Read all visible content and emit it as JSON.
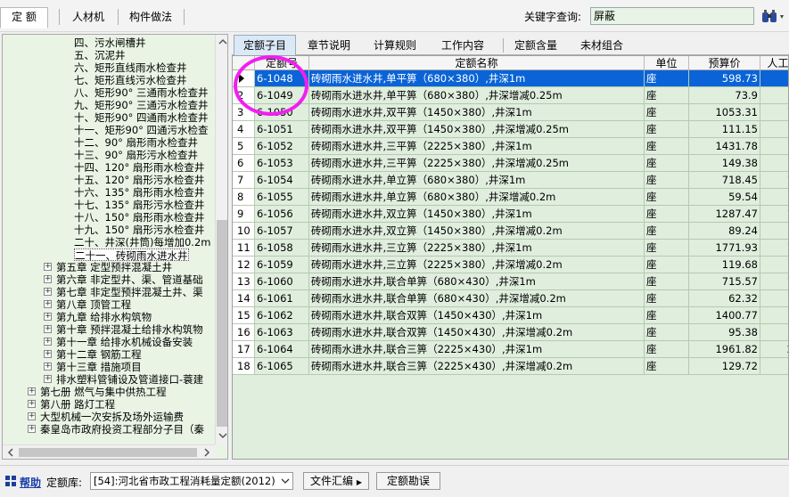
{
  "toolbar": {
    "tab_quota": "定  额",
    "tab_materials": "人材机",
    "tab_component": "构件做法",
    "keyword_label": "关键字查询:",
    "keyword_value": "屏蔽"
  },
  "tree": {
    "items": [
      {
        "label": "四、污水闸槽井",
        "indent": 80,
        "toggle": "",
        "selected": false
      },
      {
        "label": "五、沉泥井",
        "indent": 80,
        "toggle": "",
        "selected": false
      },
      {
        "label": "六、矩形直线雨水检查井",
        "indent": 80,
        "toggle": "",
        "selected": false
      },
      {
        "label": "七、矩形直线污水检查井",
        "indent": 80,
        "toggle": "",
        "selected": false
      },
      {
        "label": "八、矩形90° 三通雨水检查井",
        "indent": 80,
        "toggle": "",
        "selected": false
      },
      {
        "label": "九、矩形90° 三通污水检查井",
        "indent": 80,
        "toggle": "",
        "selected": false
      },
      {
        "label": "十、矩形90° 四通雨水检查井",
        "indent": 80,
        "toggle": "",
        "selected": false
      },
      {
        "label": "十一、矩形90° 四通污水检查",
        "indent": 80,
        "toggle": "",
        "selected": false
      },
      {
        "label": "十二、90° 扇形雨水检查井",
        "indent": 80,
        "toggle": "",
        "selected": false
      },
      {
        "label": "十三、90° 扇形污水检查井",
        "indent": 80,
        "toggle": "",
        "selected": false
      },
      {
        "label": "十四、120° 扇形雨水检查井",
        "indent": 80,
        "toggle": "",
        "selected": false
      },
      {
        "label": "十五、120° 扇形污水检查井",
        "indent": 80,
        "toggle": "",
        "selected": false
      },
      {
        "label": "十六、135° 扇形雨水检查井",
        "indent": 80,
        "toggle": "",
        "selected": false
      },
      {
        "label": "十七、135° 扇形污水检查井",
        "indent": 80,
        "toggle": "",
        "selected": false
      },
      {
        "label": "十八、150° 扇形雨水检查井",
        "indent": 80,
        "toggle": "",
        "selected": false
      },
      {
        "label": "十九、150° 扇形污水检查井",
        "indent": 80,
        "toggle": "",
        "selected": false
      },
      {
        "label": "二十、井深(井筒)每增加0.2m",
        "indent": 80,
        "toggle": "",
        "selected": false
      },
      {
        "label": "二十一、砖砌雨水进水井",
        "indent": 80,
        "toggle": "",
        "selected": true
      },
      {
        "label": "第五章 定型预拌混凝土井",
        "indent": 60,
        "toggle": "+",
        "selected": false
      },
      {
        "label": "第六章 非定型井、渠、管道基础",
        "indent": 60,
        "toggle": "+",
        "selected": false
      },
      {
        "label": "第七章 非定型预拌混凝土井、渠",
        "indent": 60,
        "toggle": "+",
        "selected": false
      },
      {
        "label": "第八章 顶管工程",
        "indent": 60,
        "toggle": "+",
        "selected": false
      },
      {
        "label": "第九章 给排水构筑物",
        "indent": 60,
        "toggle": "+",
        "selected": false
      },
      {
        "label": "第十章 预拌混凝土给排水构筑物",
        "indent": 60,
        "toggle": "+",
        "selected": false
      },
      {
        "label": "第十一章 给排水机械设备安装",
        "indent": 60,
        "toggle": "+",
        "selected": false
      },
      {
        "label": "第十二章 钢筋工程",
        "indent": 60,
        "toggle": "+",
        "selected": false
      },
      {
        "label": "第十三章 措施项目",
        "indent": 60,
        "toggle": "+",
        "selected": false
      },
      {
        "label": "排水塑料管铺设及管道接口-蓑建",
        "indent": 60,
        "toggle": "+",
        "selected": false
      },
      {
        "label": "第七册 燃气与集中供热工程",
        "indent": 42,
        "toggle": "+",
        "selected": false
      },
      {
        "label": "第八册 路灯工程",
        "indent": 42,
        "toggle": "+",
        "selected": false
      },
      {
        "label": "大型机械一次安拆及场外运输费",
        "indent": 42,
        "toggle": "+",
        "selected": false
      },
      {
        "label": "秦皇岛市政府投资工程部分子目（秦",
        "indent": 42,
        "toggle": "+",
        "selected": false
      }
    ]
  },
  "tabs": [
    {
      "label": "定额子目",
      "active": true
    },
    {
      "label": "章节说明",
      "active": false
    },
    {
      "label": "计算规则",
      "active": false
    },
    {
      "label": "工作内容",
      "active": false
    },
    {
      "label": "定额含量",
      "active": false
    },
    {
      "label": "未材组合",
      "active": false
    }
  ],
  "table": {
    "headers": [
      "定额号",
      "定额名称",
      "单位",
      "预算价",
      "人工"
    ],
    "rows": [
      {
        "rn": "",
        "code": "6-1048",
        "name": "砖砌雨水进水井,单平箅（680×380）,井深1m",
        "unit": "座",
        "price": "598.73",
        "labor": "",
        "selected": true
      },
      {
        "rn": "2",
        "code": "6-1049",
        "name": "砖砌雨水进水井,单平箅（680×380）,井深增减0.25m",
        "unit": "座",
        "price": "73.9",
        "labor": "",
        "selected": false
      },
      {
        "rn": "3",
        "code": "6-1050",
        "name": "砖砌雨水进水井,双平箅（1450×380）,井深1m",
        "unit": "座",
        "price": "1053.31",
        "labor": "1",
        "selected": false
      },
      {
        "rn": "4",
        "code": "6-1051",
        "name": "砖砌雨水进水井,双平箅（1450×380）,井深增减0.25m",
        "unit": "座",
        "price": "111.15",
        "labor": "",
        "selected": false
      },
      {
        "rn": "5",
        "code": "6-1052",
        "name": "砖砌雨水进水井,三平箅（2225×380）,井深1m",
        "unit": "座",
        "price": "1431.78",
        "labor": "",
        "selected": false
      },
      {
        "rn": "6",
        "code": "6-1053",
        "name": "砖砌雨水进水井,三平箅（2225×380）,井深增减0.25m",
        "unit": "座",
        "price": "149.38",
        "labor": "",
        "selected": false
      },
      {
        "rn": "7",
        "code": "6-1054",
        "name": "砖砌雨水进水井,单立箅（680×380）,井深1m",
        "unit": "座",
        "price": "718.45",
        "labor": "1",
        "selected": false
      },
      {
        "rn": "8",
        "code": "6-1055",
        "name": "砖砌雨水进水井,单立箅（680×380）,井深增减0.2m",
        "unit": "座",
        "price": "59.54",
        "labor": "",
        "selected": false
      },
      {
        "rn": "9",
        "code": "6-1056",
        "name": "砖砌雨水进水井,双立箅（1450×380）,井深1m",
        "unit": "座",
        "price": "1287.47",
        "labor": "1",
        "selected": false
      },
      {
        "rn": "10",
        "code": "6-1057",
        "name": "砖砌雨水进水井,双立箅（1450×380）,井深增减0.2m",
        "unit": "座",
        "price": "89.24",
        "labor": "",
        "selected": false
      },
      {
        "rn": "11",
        "code": "6-1058",
        "name": "砖砌雨水进水井,三立箅（2225×380）,井深1m",
        "unit": "座",
        "price": "1771.93",
        "labor": "1",
        "selected": false
      },
      {
        "rn": "12",
        "code": "6-1059",
        "name": "砖砌雨水进水井,三立箅（2225×380）,井深增减0.2m",
        "unit": "座",
        "price": "119.68",
        "labor": "",
        "selected": false
      },
      {
        "rn": "13",
        "code": "6-1060",
        "name": "砖砌雨水进水井,联合单箅（680×430）,井深1m",
        "unit": "座",
        "price": "715.57",
        "labor": "1",
        "selected": false
      },
      {
        "rn": "14",
        "code": "6-1061",
        "name": "砖砌雨水进水井,联合单箅（680×430）,井深增减0.2m",
        "unit": "座",
        "price": "62.32",
        "labor": "",
        "selected": false
      },
      {
        "rn": "15",
        "code": "6-1062",
        "name": "砖砌雨水进水井,联合双箅（1450×430）,井深1m",
        "unit": "座",
        "price": "1400.77",
        "labor": "",
        "selected": false
      },
      {
        "rn": "16",
        "code": "6-1063",
        "name": "砖砌雨水进水井,联合双箅（1450×430）,井深增减0.2m",
        "unit": "座",
        "price": "95.38",
        "labor": "",
        "selected": false
      },
      {
        "rn": "17",
        "code": "6-1064",
        "name": "砖砌雨水进水井,联合三箅（2225×430）,井深1m",
        "unit": "座",
        "price": "1961.82",
        "labor": "2",
        "selected": false
      },
      {
        "rn": "18",
        "code": "6-1065",
        "name": "砖砌雨水进水井,联合三箅（2225×430）,井深增减0.2m",
        "unit": "座",
        "price": "129.72",
        "labor": "",
        "selected": false
      }
    ]
  },
  "bottom": {
    "help_label": "帮助",
    "lib_label": "定额库:",
    "lib_value": "[54]:河北省市政工程消耗量定额(2012)",
    "file_btn": "文件汇编",
    "errata_btn": "定额勘误"
  },
  "colors": {
    "highlight": "#f21ef2",
    "selection": "#0a64d8",
    "grid_bg": "#dfeedd"
  }
}
